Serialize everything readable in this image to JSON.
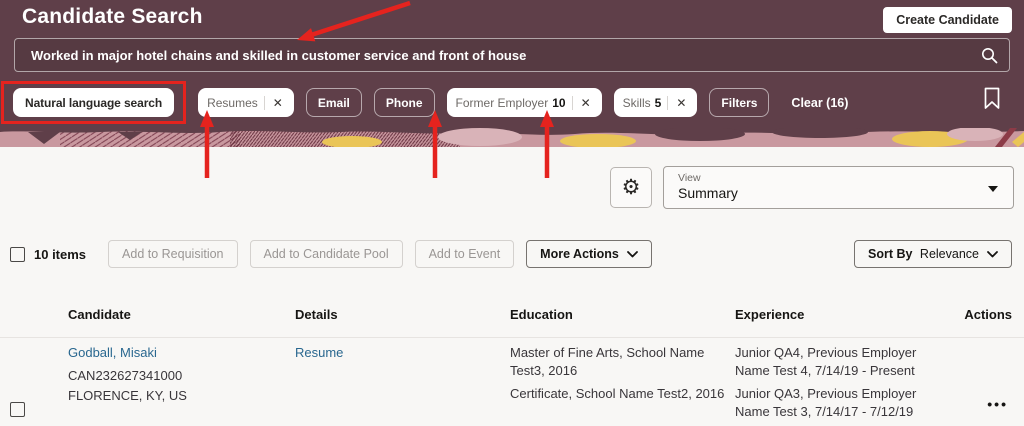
{
  "colors": {
    "header_bg": "#5f3f49",
    "band_pink": "#c9989f",
    "accent_yellow": "#eac557",
    "link_blue": "#29678f",
    "annotation_red": "#e5231e"
  },
  "header": {
    "title": "Candidate Search",
    "create_candidate_label": "Create Candidate",
    "search_value": "Worked in major hotel chains and skilled in customer service and front of house",
    "search_icon": "magnifying-glass",
    "bookmark_icon": "bookmark-outline",
    "chips": {
      "natural_language": "Natural language search",
      "resumes": "Resumes",
      "email": "Email",
      "phone": "Phone",
      "former_employer": "Former Employer",
      "former_employer_count": "10",
      "skills": "Skills",
      "skills_count": "5",
      "filters": "Filters",
      "clear": "Clear (16)",
      "close_icon": "✕"
    }
  },
  "view_bar": {
    "gear_icon": "⚙",
    "view_label": "View",
    "view_value": "Summary"
  },
  "toolbar": {
    "items_count": "10 items",
    "add_to_requisition": "Add to Requisition",
    "add_to_candidate_pool": "Add to Candidate Pool",
    "add_to_event": "Add to Event",
    "more_actions": "More Actions",
    "sort_by_prefix": "Sort By",
    "sort_by_value": "Relevance"
  },
  "table": {
    "columns": [
      "Candidate",
      "Details",
      "Education",
      "Experience",
      "Actions"
    ],
    "rows": [
      {
        "name": "Godball, Misaki",
        "id": "CAN232627341000",
        "location": "FLORENCE, KY, US",
        "details_link": "Resume",
        "education": [
          "Master of Fine Arts, School Name Test3, 2016",
          "Certificate, School Name Test2, 2016"
        ],
        "experience": [
          "Junior QA4, Previous Employer Name Test 4, 7/14/19 - Present",
          "Junior QA3, Previous Employer Name Test 3, 7/14/17 - 7/12/19"
        ],
        "actions_icon": "•••"
      }
    ]
  }
}
